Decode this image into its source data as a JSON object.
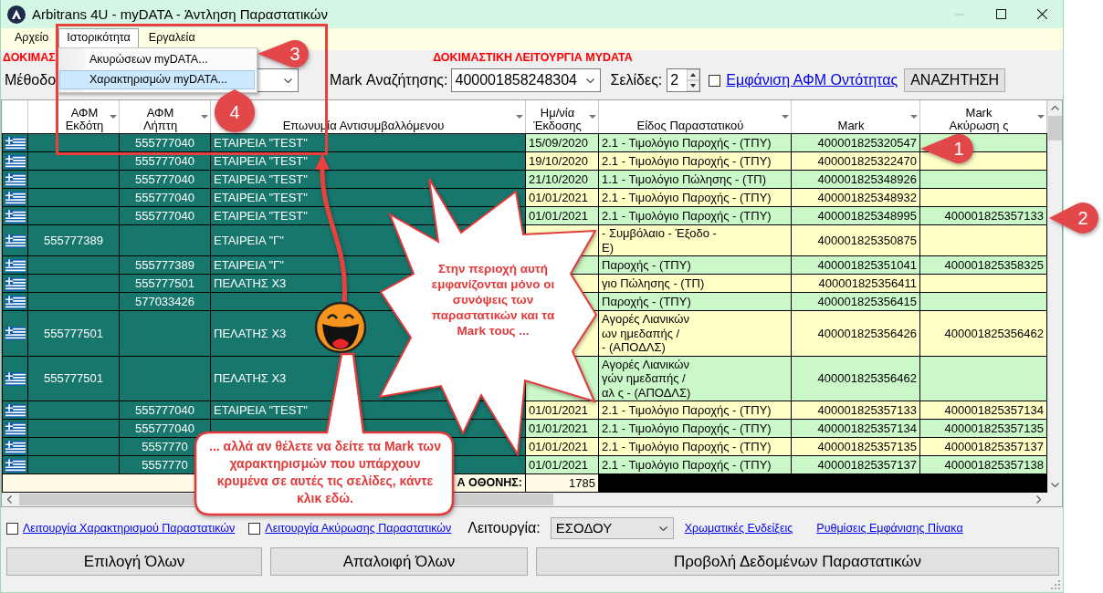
{
  "window": {
    "title": "Arbitrans 4U - myDATA - Άντληση Παραστατικών",
    "controls": [
      {
        "kind": "minimize",
        "disabled": true
      },
      {
        "kind": "maximize",
        "disabled": false
      },
      {
        "kind": "close",
        "disabled": false
      }
    ]
  },
  "menu_bar": [
    {
      "label": "Αρχείο",
      "selected": false
    },
    {
      "label": "Ιστορικότητα",
      "selected": true
    },
    {
      "label": "Εργαλεία",
      "selected": false
    }
  ],
  "dropdown_menu": [
    {
      "label": "Ακυρώσεων myDATA...",
      "selected": false
    },
    {
      "label": "Χαρακτηρισμών myDATA...",
      "selected": true
    }
  ],
  "banner": {
    "left": "ΔΟΚΙΜΑΣ",
    "center": "ΔΟΚΙΜΑΣΤΙΚΗ ΛΕΙΤΟΥΡΓΙΑ MYDATA"
  },
  "search_bar": {
    "method_label": "Μέθοδο",
    "mark_label": "Mark Αναζήτησης:",
    "mark_value": "400001858248304",
    "pages_label": "Σελίδες:",
    "pages_value": "2",
    "show_vat": {
      "label": "Εμφάνιση ΑΦΜ Οντότητας",
      "checked": false
    },
    "search_button": "ΑΝΑΖΗΤΗΣΗ"
  },
  "table": {
    "columns": [
      {
        "lines": [
          "ΑΦΜ",
          "Εκδότη"
        ]
      },
      {
        "lines": [
          "ΑΦΜ",
          "Λήπτη"
        ]
      },
      {
        "lines": [
          "Επωνυμία Αντισυμβαλλόμενου"
        ]
      },
      {
        "lines": [
          "Ημ/νία",
          "Έκδοσης"
        ]
      },
      {
        "lines": [
          "Είδος Παραστατικού"
        ]
      },
      {
        "lines": [
          "Mark"
        ]
      },
      {
        "lines": [
          "Mark",
          "Ακύρωση ς"
        ]
      }
    ],
    "rows": [
      {
        "receiver_vat": "555777040",
        "counterparty": "ΕΤΑΙΡΕΙΑ \"TEST\"",
        "date": "15/09/2020",
        "type": [
          "2.1 - Τιμολόγιο Παροχής - (ΤΠΥ)"
        ],
        "mark": "400001825320547"
      },
      {
        "receiver_vat": "555777040",
        "counterparty": "ΕΤΑΙΡΕΙΑ \"TEST\"",
        "date": "19/10/2020",
        "type": [
          "2.1 - Τιμολόγιο Παροχής - (ΤΠΥ)"
        ],
        "mark": "400001825322470"
      },
      {
        "receiver_vat": "555777040",
        "counterparty": "ΕΤΑΙΡΕΙΑ \"TEST\"",
        "date": "21/10/2020",
        "type": [
          "1.1 - Τιμολόγιο Πώλησης - (ΤΠ)"
        ],
        "mark": "400001825348926"
      },
      {
        "receiver_vat": "555777040",
        "counterparty": "ΕΤΑΙΡΕΙΑ \"TEST\"",
        "date": "01/01/2021",
        "type": [
          "2.1 - Τιμολόγιο Παροχής - (ΤΠΥ)"
        ],
        "mark": "400001825348932"
      },
      {
        "receiver_vat": "555777040",
        "counterparty": "ΕΤΑΙΡΕΙΑ \"TEST\"",
        "date": "01/01/2021",
        "type": [
          "2.1 - Τιμολόγιο Παροχής - (ΤΠΥ)"
        ],
        "mark": "400001825348995",
        "cancel_mark": "400001825357133"
      },
      {
        "issuer_vat": "555777389",
        "counterparty": "ΕΤΑΙΡΕΙΑ \"Γ\"",
        "type": [
          "- Συμβόλαιο - Έξοδο -",
          "Ε)"
        ],
        "mark": "400001825350875"
      },
      {
        "receiver_vat": "555777389",
        "counterparty": "ΕΤΑΙΡΕΙΑ \"Γ\"",
        "type": [
          "Παροχής - (ΤΠΥ)"
        ],
        "mark": "400001825351041",
        "cancel_mark": "400001825358325"
      },
      {
        "receiver_vat": "555777501",
        "counterparty": "ΠΕΛΑΤΗΣ Χ3",
        "type": [
          "γιο Πώλησης - (ΤΠ)"
        ],
        "mark": "400001825356411"
      },
      {
        "receiver_vat": "577033426",
        "type": [
          "Παροχής - (ΤΠΥ)"
        ],
        "mark": "400001825356415"
      },
      {
        "issuer_vat": "555777501",
        "counterparty": "ΠΕΛΑΤΗΣ Χ3",
        "type": [
          "Αγορές Λιανικών",
          "ων ημεδαπής /",
          "- (ΑΠΟΔΛΣ)"
        ],
        "mark": "400001825356426",
        "cancel_mark": "400001825356462"
      },
      {
        "issuer_vat": "555777501",
        "counterparty": "ΠΕΛΑΤΗΣ Χ3",
        "type": [
          "Αγορές Λιανικών",
          "γών ημεδαπής /",
          "αλ ς - (ΑΠΟΔΛΣ)"
        ],
        "mark": "400001825356462"
      },
      {
        "receiver_vat": "555777040",
        "counterparty": "ΕΤΑΙΡΕΙΑ \"TEST\"",
        "date": "01/01/2021",
        "type": [
          "2.1 - Τιμολόγιο Παροχής - (ΤΠΥ)"
        ],
        "mark": "400001825357133",
        "cancel_mark": "400001825357134"
      },
      {
        "receiver_vat": "555777040",
        "date": "01/01/2021",
        "type": [
          "2.1 - Τιμολόγιο Παροχής - (ΤΠΥ)"
        ],
        "mark": "400001825357134",
        "cancel_mark": "400001825357135"
      },
      {
        "receiver_vat": "5557770",
        "date": "01/01/2021",
        "type": [
          "2.1 - Τιμολόγιο Παροχής - (ΤΠΥ)"
        ],
        "mark": "400001825357135",
        "cancel_mark": "400001825357137"
      },
      {
        "receiver_vat": "5557770",
        "date": "01/01/2021",
        "type": [
          "2.1 - Τιμολόγιο Παροχής - (ΤΠΥ)"
        ],
        "mark": "400001825357137",
        "cancel_mark": "400001825357138"
      }
    ],
    "footer": {
      "label": "Α ΟΘΟΝΗΣ:",
      "count": "1785"
    }
  },
  "bottom_bar": {
    "options": [
      {
        "label": "Λειτουργία Χαρακτηρισμού Παραστατικών",
        "checked": false
      },
      {
        "label": "Λειτουργία Ακύρωσης Παραστατικών",
        "checked": false
      }
    ],
    "mode_label": "Λειτουργία:",
    "mode_value": "ΕΣΟΔΟΥ",
    "links": [
      "Χρωματικές Ενδείξεις",
      "Ρυθμίσεις Εμφάνισης Πίνακα"
    ],
    "buttons": [
      "Επιλογή Όλων",
      "Απαλοιφή Όλων",
      "Προβολή Δεδομένων Παραστατικών"
    ]
  },
  "annotations": {
    "callouts": [
      {
        "number": "1"
      },
      {
        "number": "2"
      },
      {
        "number": "3"
      },
      {
        "number": "4"
      }
    ],
    "starburst_text": "Στην περιοχή αυτή εμφανίζονται μόνο οι συνόψεις των παραστατικών και τα Mark τους ...",
    "bubble_text": "... αλλά αν θέλετε να δείτε τα Mark των χαρακτηρισμών που υπάρχουν κρυμένα σε αυτές τις σελίδες, κάντε κλικ εδώ."
  }
}
